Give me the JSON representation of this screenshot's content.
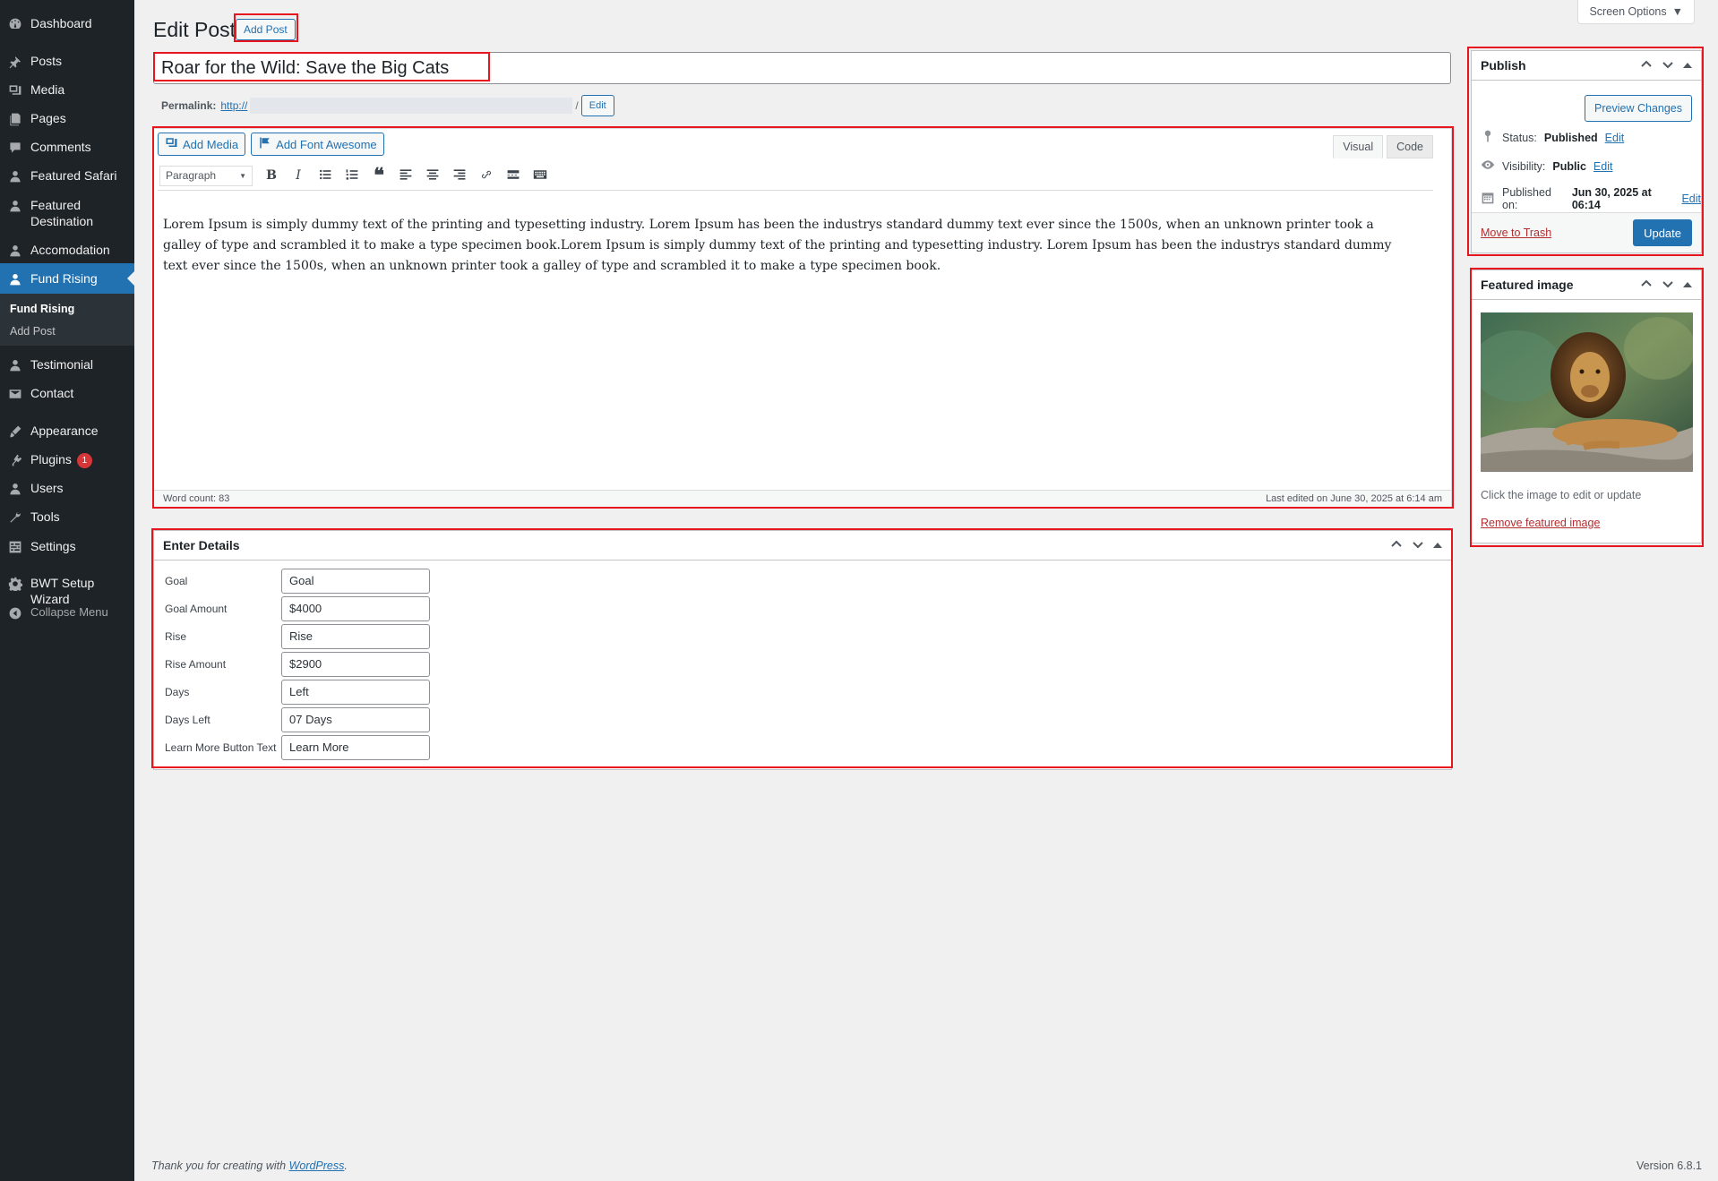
{
  "sidebar": {
    "items": [
      {
        "label": "Dashboard",
        "icon": "dashboard-icon"
      },
      {
        "label": "Posts",
        "icon": "pin-icon"
      },
      {
        "label": "Media",
        "icon": "media-icon"
      },
      {
        "label": "Pages",
        "icon": "pages-icon"
      },
      {
        "label": "Comments",
        "icon": "comments-icon"
      },
      {
        "label": "Featured Safari",
        "icon": "user-icon"
      },
      {
        "label": "Featured Destination",
        "icon": "user-icon"
      },
      {
        "label": "Accomodation",
        "icon": "user-icon"
      },
      {
        "label": "Fund Rising",
        "icon": "user-icon"
      },
      {
        "label": "Testimonial",
        "icon": "user-icon"
      },
      {
        "label": "Contact",
        "icon": "mail-icon"
      },
      {
        "label": "Appearance",
        "icon": "brush-icon"
      },
      {
        "label": "Plugins",
        "icon": "plugin-icon",
        "badge": "1"
      },
      {
        "label": "Users",
        "icon": "users-icon"
      },
      {
        "label": "Tools",
        "icon": "wrench-icon"
      },
      {
        "label": "Settings",
        "icon": "settings-icon"
      },
      {
        "label": "BWT Setup Wizard",
        "icon": "gear-icon"
      },
      {
        "label": "Collapse Menu",
        "icon": "collapse-icon"
      }
    ],
    "submenu": [
      {
        "label": "Fund Rising",
        "current": true
      },
      {
        "label": "Add Post",
        "current": false
      }
    ]
  },
  "header": {
    "title": "Edit Post",
    "add_post": "Add Post",
    "screen_options": "Screen Options"
  },
  "post": {
    "title": "Roar for the Wild: Save the Big Cats",
    "permalink_label": "Permalink:",
    "permalink_url": "http://",
    "permalink_suffix": "/",
    "permalink_edit": "Edit"
  },
  "editor": {
    "add_media": "Add Media",
    "add_font_awesome": "Add Font Awesome",
    "tab_visual": "Visual",
    "tab_code": "Code",
    "format_select": "Paragraph",
    "content": "Lorem Ipsum is simply dummy text of the printing and typesetting industry. Lorem Ipsum has been the industrys standard dummy text ever since the 1500s, when an unknown printer took a galley of type and scrambled it to make a type specimen book.Lorem Ipsum is simply dummy text of the printing and typesetting industry. Lorem Ipsum has been the industrys standard dummy text ever since the 1500s, when an unknown printer took a galley of type and scrambled it to make a type specimen book.",
    "word_count": "Word count: 83",
    "last_edited": "Last edited on June 30, 2025 at 6:14 am"
  },
  "details": {
    "title": "Enter Details",
    "fields": [
      {
        "label": "Goal",
        "value": "Goal"
      },
      {
        "label": "Goal Amount",
        "value": "$4000"
      },
      {
        "label": "Rise",
        "value": "Rise"
      },
      {
        "label": "Rise Amount",
        "value": "$2900"
      },
      {
        "label": "Days",
        "value": "Left"
      },
      {
        "label": "Days Left",
        "value": "07 Days"
      },
      {
        "label": "Learn More Button Text",
        "value": "Learn More"
      }
    ]
  },
  "publish": {
    "title": "Publish",
    "preview": "Preview Changes",
    "status_label": "Status:",
    "status_value": "Published",
    "visibility_label": "Visibility:",
    "visibility_value": "Public",
    "published_label": "Published on:",
    "published_value": "Jun 30, 2025 at 06:14",
    "edit": "Edit",
    "trash": "Move to Trash",
    "update": "Update"
  },
  "featured": {
    "title": "Featured image",
    "note": "Click the image to edit or update",
    "remove": "Remove featured image"
  },
  "footer": {
    "thanks": "Thank you for creating with",
    "wp_link": "WordPress",
    "period": ".",
    "version": "Version 6.8.1"
  },
  "colors": {
    "admin_bar": "#1d2327",
    "accent": "#2271b1",
    "highlight": "#e6151e",
    "danger": "#b32d2e"
  }
}
